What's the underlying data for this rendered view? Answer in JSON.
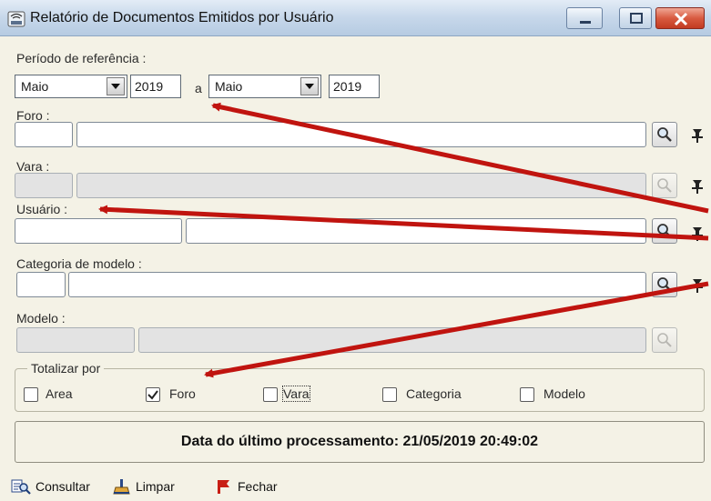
{
  "window": {
    "title": "Relatório de Documentos Emitidos por Usuário"
  },
  "periodo": {
    "label": "Período de referência :",
    "start_month": "Maio",
    "start_year": "2019",
    "separator": "a",
    "end_month": "Maio",
    "end_year": "2019"
  },
  "foro": {
    "label": "Foro :"
  },
  "vara": {
    "label": "Vara :"
  },
  "usuario": {
    "label": "Usuário :"
  },
  "categoria": {
    "label": "Categoria de modelo :"
  },
  "modelo": {
    "label": "Modelo :"
  },
  "totalizar": {
    "legend": "Totalizar por",
    "options": [
      {
        "label": "Area",
        "checked": false
      },
      {
        "label": "Foro",
        "checked": true
      },
      {
        "label": "Vara",
        "checked": false
      },
      {
        "label": "Categoria",
        "checked": false
      },
      {
        "label": "Modelo",
        "checked": false
      }
    ]
  },
  "status": {
    "text": "Data do último processamento: 21/05/2019 20:49:02"
  },
  "toolbar": {
    "consultar": "Consultar",
    "limpar": "Limpar",
    "fechar": "Fechar"
  },
  "icons": {
    "search": "magnifier-icon",
    "pin": "pin-icon",
    "dropdown": "chevron-down-icon"
  },
  "colors": {
    "annotation_arrow": "#c0140f",
    "titlebar": "#c6d7ea",
    "close_button": "#c23b22",
    "window_bg": "#f4f2e6"
  }
}
